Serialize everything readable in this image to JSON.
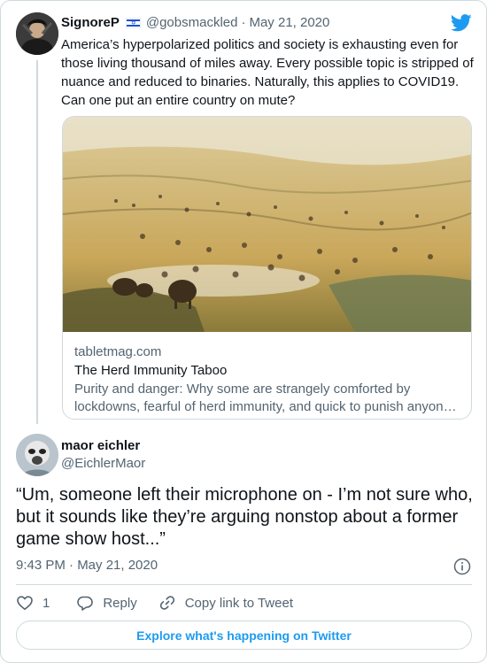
{
  "quoted_tweet": {
    "author_name": "SignoreP",
    "flag_icon": "israel-flag-icon",
    "handle": "@gobsmackled",
    "separator": "·",
    "date": "May 21, 2020",
    "text": "America’s hyperpolarized politics and society is exhausting even for those living thousand of miles away. Every possible topic is stripped of nuance and reduced to binaries. Naturally, this applies to COVID19. Can one put an entire country on mute?",
    "link_card": {
      "domain": "tabletmag.com",
      "title": "The Herd Immunity Taboo",
      "description_line1": "Purity and danger: Why some are strangely comforted by",
      "description_line2": "lockdowns, fearful of herd immunity, and quick to punish anyon…"
    }
  },
  "main_tweet": {
    "author_name": "maor eichler",
    "handle": "@EichlerMaor",
    "text": "“Um, someone left their microphone on - I’m not sure who, but it sounds like they’re arguing nonstop about a former game show host...”",
    "timestamp": "9:43 PM · May 21, 2020",
    "info_icon": "info-icon"
  },
  "actions": {
    "like_count": "1",
    "reply_label": "Reply",
    "copy_link_label": "Copy link to Tweet"
  },
  "explore_label": "Explore what's happening on Twitter",
  "colors": {
    "twitter_blue": "#1d9bf0",
    "border": "#cfd9de",
    "secondary_text": "#536471",
    "primary_text": "#0f1419"
  }
}
